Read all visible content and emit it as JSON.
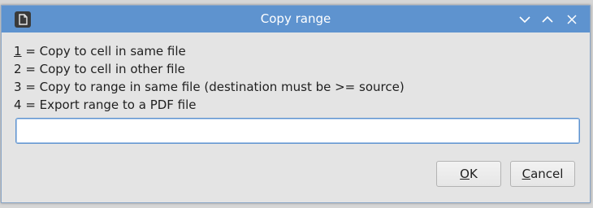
{
  "window": {
    "title": "Copy range"
  },
  "options": [
    {
      "key": "1",
      "key_underlined": true,
      "text": " = Copy to cell in same file"
    },
    {
      "key": "2",
      "key_underlined": false,
      "text": " = Copy to cell in other file"
    },
    {
      "key": "3",
      "key_underlined": false,
      "text": " = Copy to range in same file (destination must be >= source)"
    },
    {
      "key": "4",
      "key_underlined": false,
      "text": " = Export range to a PDF file"
    }
  ],
  "input": {
    "value": ""
  },
  "buttons": {
    "ok": {
      "mnemonic": "O",
      "rest": "K"
    },
    "cancel": {
      "mnemonic": "C",
      "rest": "ancel"
    }
  },
  "colors": {
    "titlebar": "#5e93cf",
    "dialog_bg": "#e4e4e4",
    "focus_border": "#5e93cf"
  },
  "icons": {
    "app": "document-app-icon",
    "minimize": "chevron-down-icon",
    "maximize": "chevron-up-icon",
    "close": "close-icon"
  }
}
